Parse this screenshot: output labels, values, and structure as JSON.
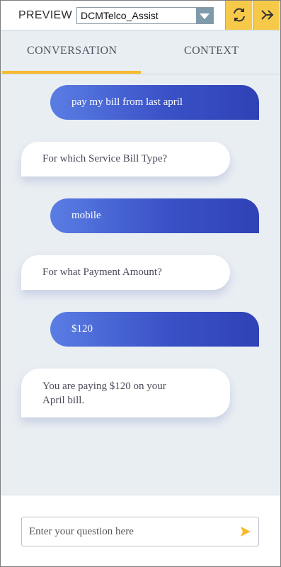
{
  "header": {
    "preview_label": "PREVIEW",
    "bot_select": {
      "selected": "DCMTelco_Assist"
    },
    "refresh_icon": "refresh-icon",
    "forward_icon": "double-arrow-right-icon"
  },
  "tabs": [
    {
      "label": "CONVERSATION",
      "active": true
    },
    {
      "label": "CONTEXT",
      "active": false
    }
  ],
  "messages": [
    {
      "from": "user",
      "text": "pay my bill from last april"
    },
    {
      "from": "bot",
      "text": "For which Service Bill Type?"
    },
    {
      "from": "user",
      "text": "mobile"
    },
    {
      "from": "bot",
      "text": "For what Payment Amount?"
    },
    {
      "from": "user",
      "text": "$120"
    },
    {
      "from": "bot",
      "text": "You are paying $120 on your April bill."
    }
  ],
  "input": {
    "placeholder": "Enter your question here",
    "value": ""
  },
  "colors": {
    "accent": "#f7c948",
    "user_bubble_start": "#5a7de3",
    "user_bubble_end": "#2f42b6",
    "background": "#e9eef3",
    "send_icon": "#f7b92e"
  }
}
